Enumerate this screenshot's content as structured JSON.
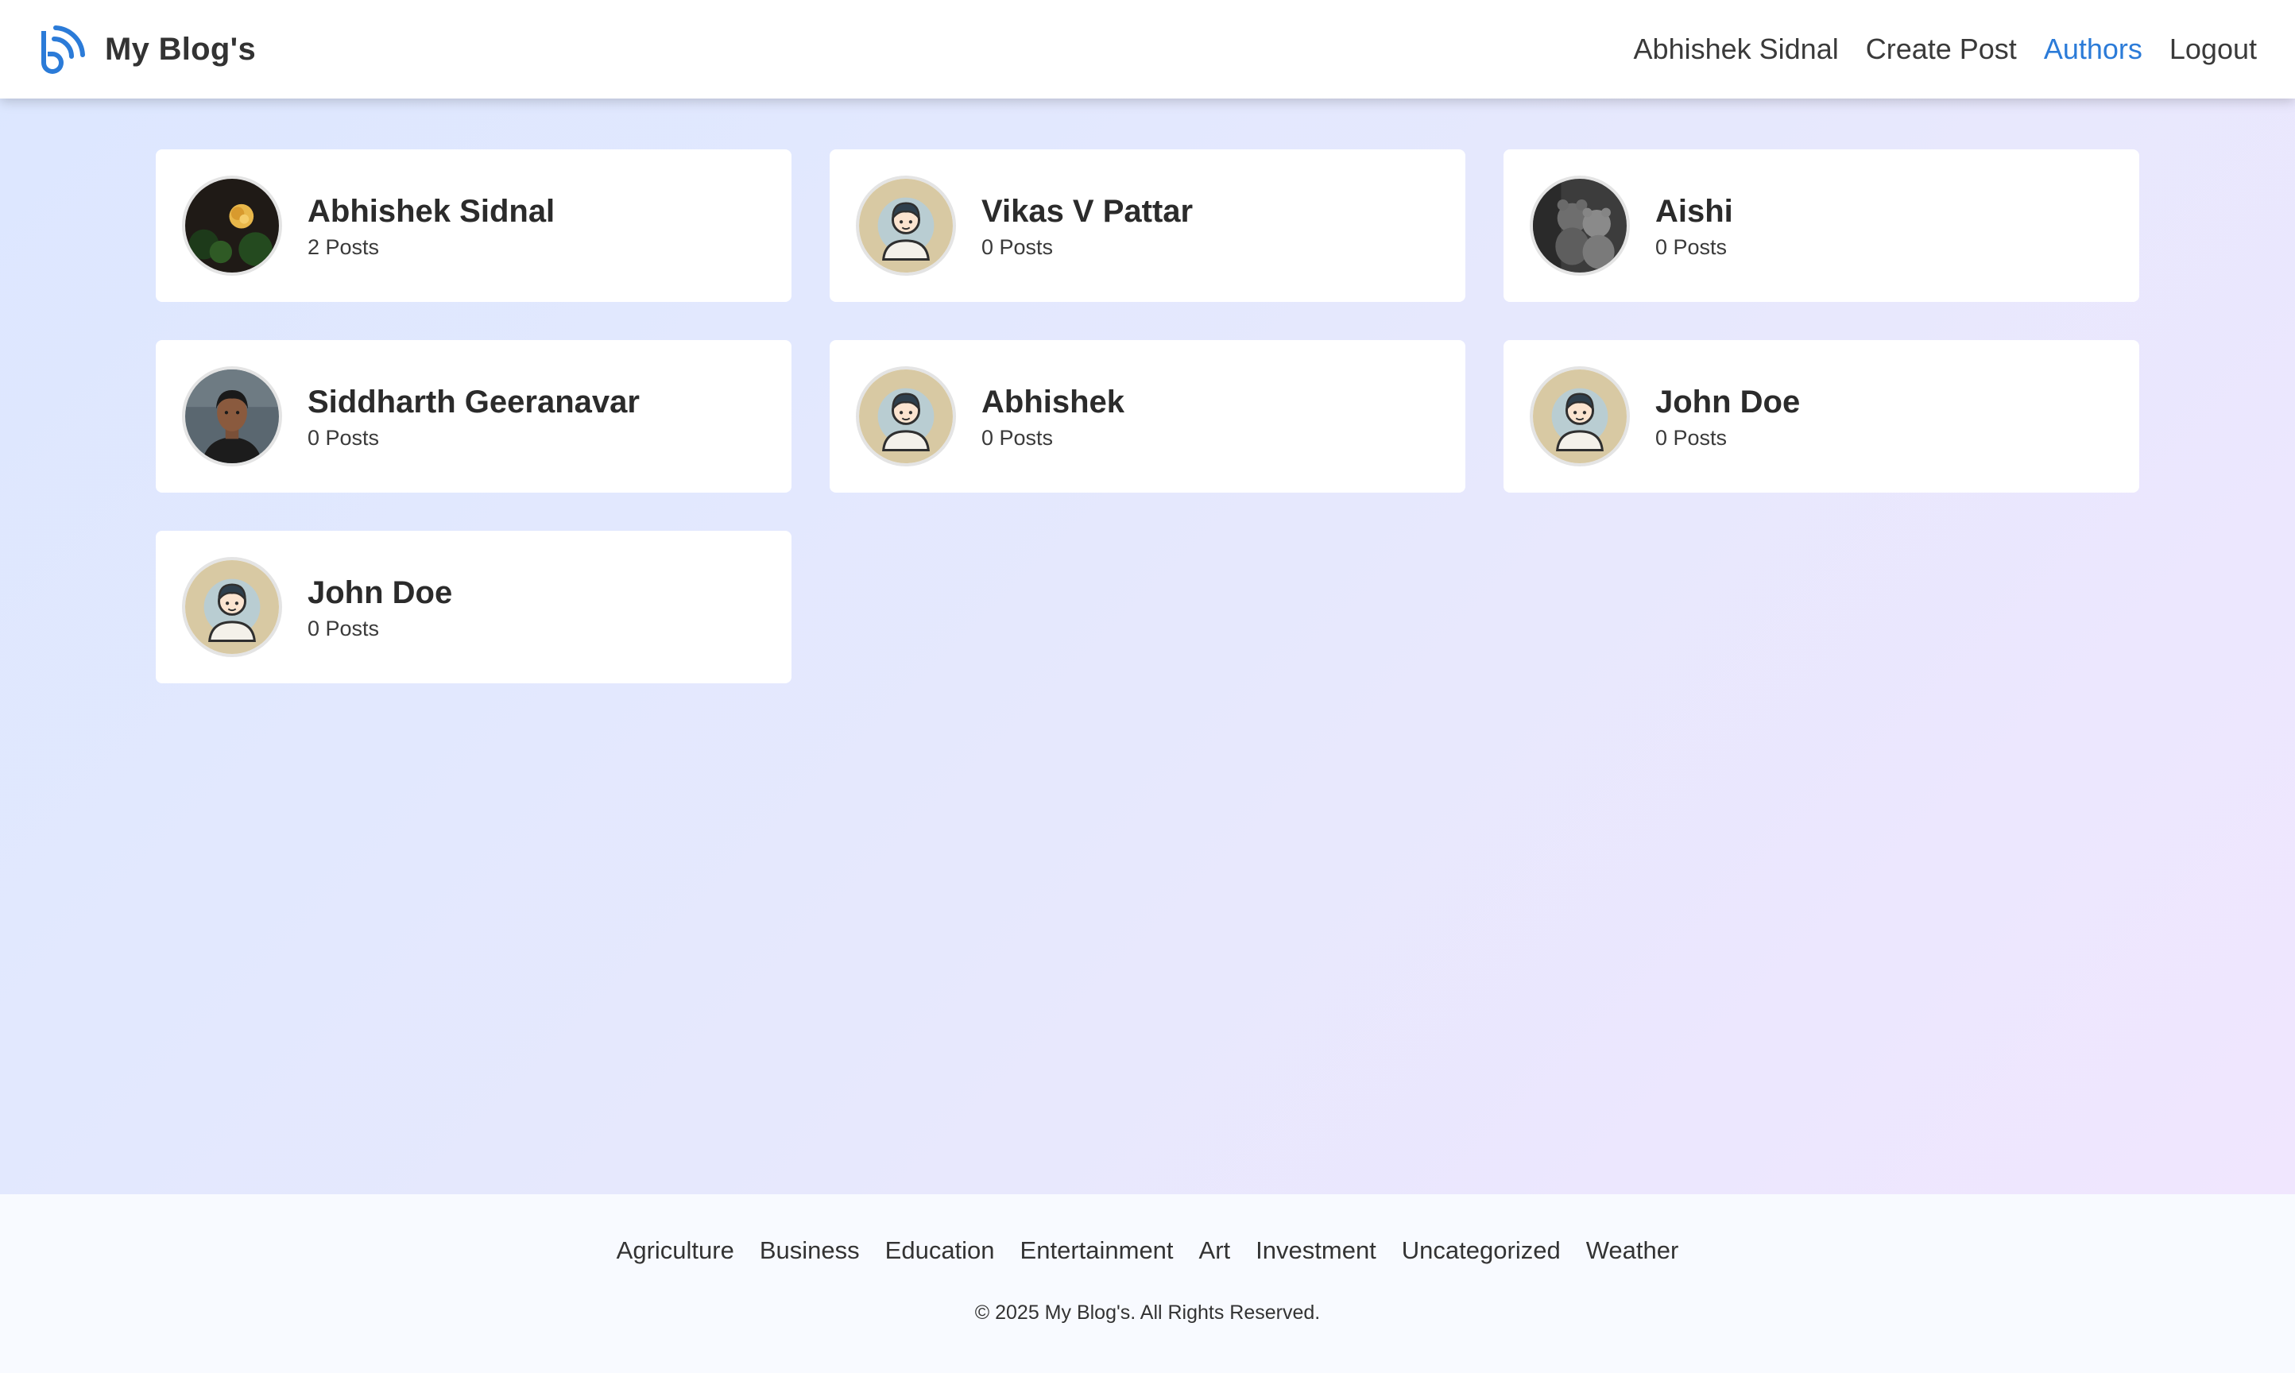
{
  "header": {
    "brand": "My Blog's",
    "logo_icon": "blog-b-icon",
    "nav": [
      {
        "label": "Abhishek Sidnal",
        "active": false
      },
      {
        "label": "Create Post",
        "active": false
      },
      {
        "label": "Authors",
        "active": true
      },
      {
        "label": "Logout",
        "active": false
      }
    ],
    "accent_color": "#2b7bd8"
  },
  "authors": [
    {
      "name": "Abhishek Sidnal",
      "posts": "2 Posts",
      "avatar": "flower-photo"
    },
    {
      "name": "Vikas V Pattar",
      "posts": "0 Posts",
      "avatar": "default-cartoon-avatar"
    },
    {
      "name": "Aishi",
      "posts": "0 Posts",
      "avatar": "teddy-bears-photo"
    },
    {
      "name": "Siddharth Geeranavar",
      "posts": "0 Posts",
      "avatar": "person-photo"
    },
    {
      "name": "Abhishek",
      "posts": "0 Posts",
      "avatar": "default-cartoon-avatar"
    },
    {
      "name": "John Doe",
      "posts": "0 Posts",
      "avatar": "default-cartoon-avatar"
    },
    {
      "name": "John Doe",
      "posts": "0 Posts",
      "avatar": "default-cartoon-avatar"
    }
  ],
  "footer": {
    "categories": [
      "Agriculture",
      "Business",
      "Education",
      "Entertainment",
      "Art",
      "Investment",
      "Uncategorized",
      "Weather"
    ],
    "copyright": "© 2025 My Blog's. All Rights Reserved."
  }
}
